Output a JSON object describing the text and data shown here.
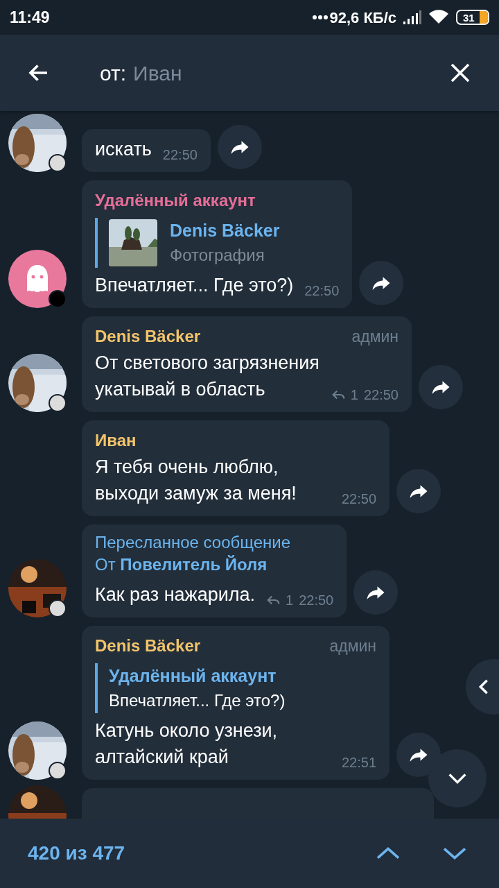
{
  "status_bar": {
    "time": "11:49",
    "speed": "92,6 КБ/с",
    "battery": "31"
  },
  "search": {
    "prefix": "от:",
    "query": "Иван"
  },
  "messages": [
    {
      "text": "искать",
      "time": "22:50"
    },
    {
      "kind": "ghost",
      "name": "Удалённый аккаунт",
      "color": "#e56e97",
      "reply": {
        "name": "Denis Bäcker",
        "text": "Фотография",
        "kind": "picture"
      },
      "text": "Впечатляет... Где это?)",
      "time": "22:50"
    },
    {
      "name": "Denis Bäcker",
      "color": "#f2c46b",
      "badge": "админ",
      "text": "От светового загрязнения укатывай в область",
      "replies": "1",
      "time": "22:50"
    },
    {
      "kind": "none",
      "name": "Иван",
      "color": "#f2c46b",
      "text": "Я тебя очень люблю, выходи замуж за меня!",
      "time": "22:50"
    },
    {
      "kind": "dark",
      "forward": {
        "label": "Пересланное сообщение",
        "prefix": "От",
        "from": "Повелитель Йоля"
      },
      "text": "Как раз нажарила.",
      "replies": "1",
      "time": "22:50"
    },
    {
      "name": "Denis Bäcker",
      "color": "#f2c46b",
      "badge": "админ",
      "reply": {
        "name": "Удалённый аккаунт",
        "text": "Впечатляет... Где это?)",
        "kind": "text"
      },
      "text": "Катунь около узнези, алтайский край",
      "time": "22:51"
    },
    {
      "kind": "dark"
    }
  ],
  "results": {
    "counter": "420 из 477"
  }
}
